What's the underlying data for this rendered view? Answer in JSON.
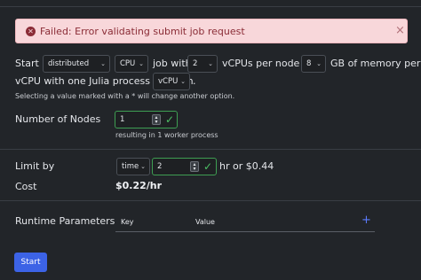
{
  "alert": {
    "message": "Failed: Error validating submit job request",
    "icon": "x-circle-icon",
    "close": "×"
  },
  "form": {
    "start_a": "Start a",
    "mode": "distributed",
    "device": "CPU",
    "job_with": "job with",
    "vcpus": "2",
    "vcpus_per_node": "vCPUs per node and",
    "memory": "8",
    "memory_suffix": "GB of memory per",
    "line2_prefix": "vCPU with one Julia process for each",
    "process_unit": "vCPU",
    "line2_suffix": ".",
    "hint": "Selecting a value marked with a * will change another option.",
    "nodes_label": "Number of Nodes",
    "nodes_value": "1",
    "nodes_note": "resulting in 1 worker process",
    "limit_label": "Limit by",
    "limit_type": "time",
    "limit_value": "2",
    "limit_suffix": "hr or $0.44",
    "cost_label": "Cost",
    "cost_value": "$0.22/hr",
    "runtime_label": "Runtime Parameters",
    "col_key": "Key",
    "col_value": "Value",
    "add": "+",
    "start_button": "Start"
  },
  "colors": {
    "accent": "#3c63e6",
    "success": "#4cc065",
    "error_bg": "#f8d7da",
    "error_text": "#8a2c36"
  }
}
